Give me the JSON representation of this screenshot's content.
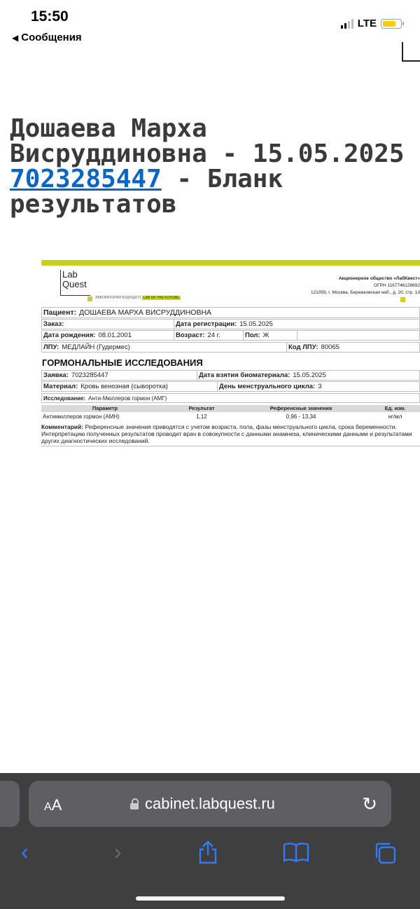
{
  "status_bar": {
    "time": "15:50",
    "back_label": "Сообщения",
    "network": "LTE"
  },
  "page": {
    "heading_name": "Дошаева Марха",
    "heading_line2": "Висруддиновна - 15.05.2025",
    "order_link": "7023285447",
    "heading_rest": " - Бланк",
    "heading_line4": "результатов"
  },
  "doc": {
    "logo_line1": "Lab",
    "logo_line2": "Quest",
    "tagline_a": "ЛАБОРАТОРИЯ БУДУЩЕГО",
    "tagline_b": "LAB OF THE FUTURE",
    "org_name": "Акционерное общество «ЛабКвест»",
    "org_ogrn": "ОГРН 1167746128692",
    "org_address": "121059, г. Москва, Бережковская наб., д. 20, стр. 13",
    "patient_label": "Пациент:",
    "patient_value": "ДОШАЕВА МАРХА ВИСРУДДИНОВНА",
    "order_label": "Заказ:",
    "reg_date_label": "Дата регистрации:",
    "reg_date_value": "15.05.2025",
    "birth_label": "Дата рождения:",
    "birth_value": "08.01.2001",
    "age_label": "Возраст:",
    "age_value": "24 г.",
    "sex_label": "Пол:",
    "sex_value": "Ж",
    "lpu_label": "ЛПУ:",
    "lpu_value": "МЕДЛАЙН (Гудермес)",
    "lpu_code_label": "Код ЛПУ:",
    "lpu_code_value": "80065",
    "section_title": "ГОРМОНАЛЬНЫЕ ИССЛЕДОВАНИЯ",
    "request_label": "Заявка:",
    "request_value": "7023285447",
    "sample_date_label": "Дата взятия биоматериала:",
    "sample_date_value": "15.05.2025",
    "material_label": "Материал:",
    "material_value": "Кровь венозная (сыворотка)",
    "cycle_day_label": "День менструального цикла:",
    "cycle_day_value": "3",
    "study_label": "Исследование:",
    "study_value": "Анти-Мюллеров гормон (АМГ)",
    "table_headers": [
      "Параметр",
      "Результат",
      "Референсные значения",
      "Ед. изм."
    ],
    "table_rows": [
      [
        "Антимюллеров гормон (АМН)",
        "1,12",
        "0,96 - 13,34",
        "нг/мл"
      ]
    ],
    "comment_label": "Комментарий:",
    "comment_text": "Референсные значения приводятся с учетом возраста, пола, фазы менструального цикла, срока беременности. Интерпретацию полученных результатов проводит врач в совокупности с данными анамнеза, клиническими данными и результатами других диагностических исследований."
  },
  "browser": {
    "text_size_label": "AA",
    "url": "cabinet.labquest.ru",
    "accent_color": "#2f7cf6"
  },
  "colors": {
    "brand_green": "#c5d41a",
    "link_blue": "#0a66c2"
  }
}
